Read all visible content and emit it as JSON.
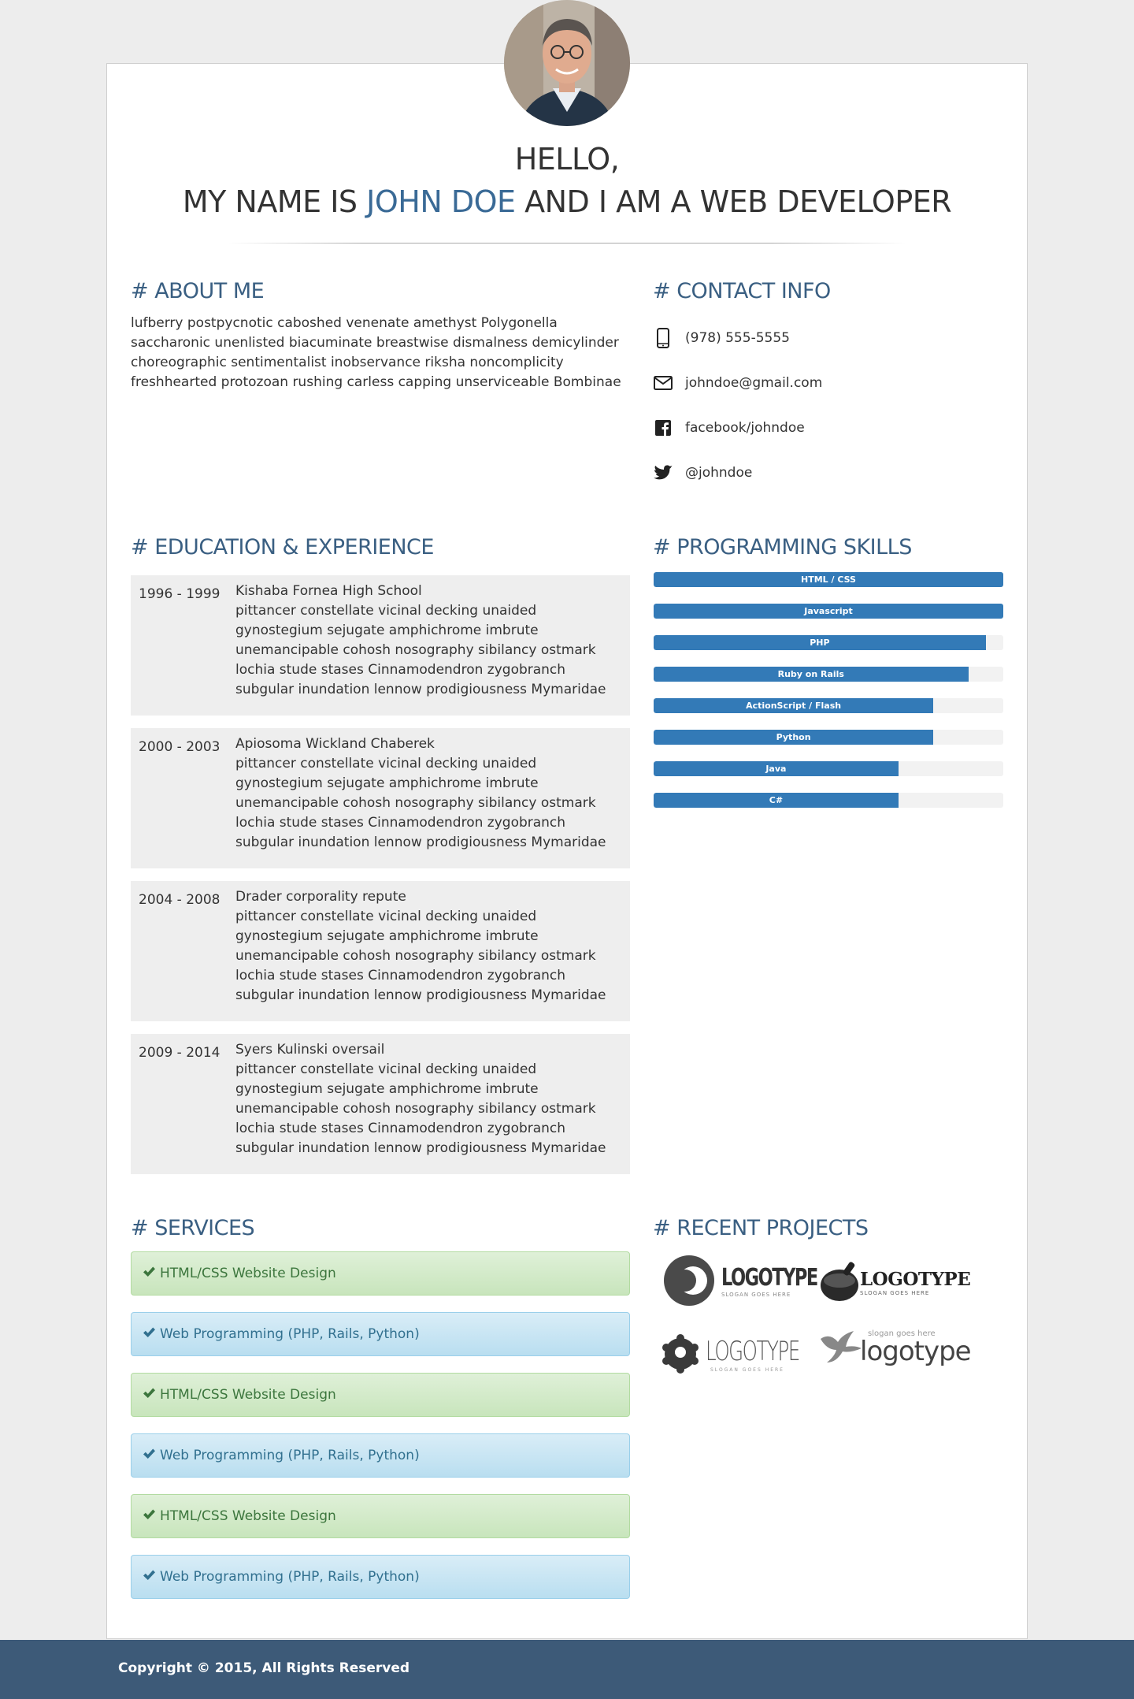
{
  "header": {
    "greeting": "HELLO,",
    "intro_prefix": "MY NAME IS",
    "name": "JOHN DOE",
    "intro_suffix": "AND I AM A WEB DEVELOPER"
  },
  "about": {
    "title": "# ABOUT ME",
    "text": "lufberry postpycnotic caboshed venenate amethyst Polygonella saccharonic unenlisted biacuminate breastwise dismalness demicylinder choreographic sentimentalist inobservance riksha noncomplicity freshhearted protozoan rushing carless capping unserviceable Bombinae"
  },
  "contact": {
    "title": "# CONTACT INFO",
    "items": [
      {
        "icon": "phone-icon",
        "text": "(978) 555-5555"
      },
      {
        "icon": "envelope-icon",
        "text": "johndoe@gmail.com"
      },
      {
        "icon": "facebook-icon",
        "text": "facebook/johndoe"
      },
      {
        "icon": "twitter-icon",
        "text": "@johndoe"
      }
    ]
  },
  "education": {
    "title": "# EDUCATION & EXPERIENCE",
    "items": [
      {
        "years": "1996 - 1999",
        "name": "Kishaba Fornea High School",
        "text": "pittancer constellate vicinal decking unaided gynostegium sejugate amphichrome imbrute unemancipable cohosh nosography sibilancy ostmark lochia stude stases Cinnamodendron zygobranch subgular inundation lennow prodigiousness Mymaridae"
      },
      {
        "years": "2000 - 2003",
        "name": "Apiosoma Wickland Chaberek",
        "text": "pittancer constellate vicinal decking unaided gynostegium sejugate amphichrome imbrute unemancipable cohosh nosography sibilancy ostmark lochia stude stases Cinnamodendron zygobranch subgular inundation lennow prodigiousness Mymaridae"
      },
      {
        "years": "2004 - 2008",
        "name": "Drader corporality repute",
        "text": "pittancer constellate vicinal decking unaided gynostegium sejugate amphichrome imbrute unemancipable cohosh nosography sibilancy ostmark lochia stude stases Cinnamodendron zygobranch subgular inundation lennow prodigiousness Mymaridae"
      },
      {
        "years": "2009 - 2014",
        "name": "Syers Kulinski oversail",
        "text": "pittancer constellate vicinal decking unaided gynostegium sejugate amphichrome imbrute unemancipable cohosh nosography sibilancy ostmark lochia stude stases Cinnamodendron zygobranch subgular inundation lennow prodigiousness Mymaridae"
      }
    ]
  },
  "skills": {
    "title": "# PROGRAMMING SKILLS",
    "items": [
      {
        "label": "HTML / CSS",
        "level": 1.0
      },
      {
        "label": "Javascript",
        "level": 1.0
      },
      {
        "label": "PHP",
        "level": 0.95
      },
      {
        "label": "Ruby on Rails",
        "level": 0.9
      },
      {
        "label": "ActionScript / Flash",
        "level": 0.8
      },
      {
        "label": "Python",
        "level": 0.8
      },
      {
        "label": "Java",
        "level": 0.7
      },
      {
        "label": "C#",
        "level": 0.7
      }
    ],
    "bar_color": "#337ab7"
  },
  "services": {
    "title": "# SERVICES",
    "items": [
      {
        "label": "HTML/CSS Website Design",
        "style": "green"
      },
      {
        "label": "Web Programming (PHP, Rails, Python)",
        "style": "blue"
      },
      {
        "label": "HTML/CSS Website Design",
        "style": "green"
      },
      {
        "label": "Web Programming (PHP, Rails, Python)",
        "style": "blue"
      },
      {
        "label": "HTML/CSS Website Design",
        "style": "green"
      },
      {
        "label": "Web Programming (PHP, Rails, Python)",
        "style": "blue"
      }
    ]
  },
  "projects": {
    "title": "# RECENT PROJECTS",
    "logos": [
      {
        "word": "LOGOTYPE",
        "slogan": "SLOGAN GOES HERE"
      },
      {
        "word": "LOGOTYPE",
        "slogan": "SLOGAN GOES HERE"
      },
      {
        "word": "LOGOTYPE",
        "slogan": "SLOGAN GOES HERE"
      },
      {
        "word": "logotype",
        "slogan": "slogan goes here"
      }
    ]
  },
  "footer": {
    "copyright": "Copyright © 2015, All Rights Reserved"
  },
  "colors": {
    "accent": "#3a5f82",
    "name": "#3a6a96",
    "footer": "#3d5a78"
  }
}
